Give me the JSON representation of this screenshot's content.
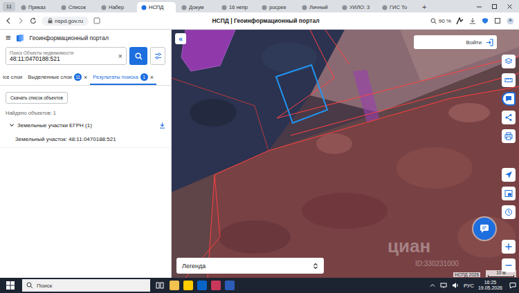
{
  "browser": {
    "tab_group": "11",
    "tabs": [
      {
        "label": "Приказ",
        "selected": false
      },
      {
        "label": "Список",
        "selected": false
      },
      {
        "label": "Набер",
        "selected": false
      },
      {
        "label": "НСПД",
        "selected": true
      },
      {
        "label": "Докум",
        "selected": false
      },
      {
        "label": "16 непр",
        "selected": false
      },
      {
        "label": "росрее",
        "selected": false
      },
      {
        "label": "Личный",
        "selected": false
      },
      {
        "label": "УИЛО: 3",
        "selected": false
      },
      {
        "label": "ГИС То",
        "selected": false
      }
    ],
    "new_tab": "+",
    "address": "nspd.gov.ru",
    "title": "НСПД | Геоинформационный портал",
    "zoom": "90 %"
  },
  "panel": {
    "menu": "≡",
    "title": "Геоинформационный портал",
    "search": {
      "label": "Поиск Объекты недвижимости",
      "value": "48:11:0470188:521",
      "clear": "×"
    },
    "tabs": [
      {
        "label": "ice слои",
        "selected": false
      },
      {
        "label": "Выделенные слои",
        "badge": "11",
        "close": "×",
        "selected": false
      },
      {
        "label": "Результаты поиска",
        "badge": "1",
        "close": "×",
        "selected": true
      }
    ],
    "download_button": "Скачать список объектов",
    "found": "Найдено объектов: 1",
    "groups": [
      {
        "label": "Земельные участки ЕГРН (1)",
        "expanded": true,
        "items": [
          "Земельный участок: 48:11:0470188:521"
        ]
      }
    ]
  },
  "map": {
    "collapse": "«",
    "login": "Войти",
    "tools": [
      {
        "kind": "layers",
        "selected": false
      },
      {
        "kind": "ruler",
        "selected": false
      },
      {
        "kind": "identify",
        "selected": true
      },
      {
        "kind": "share",
        "selected": false
      },
      {
        "kind": "print",
        "selected": false
      },
      {
        "kind": "locate",
        "selected": false
      },
      {
        "kind": "minimap",
        "selected": false
      },
      {
        "kind": "history",
        "selected": false
      },
      {
        "kind": "zoom-in",
        "selected": false
      },
      {
        "kind": "zoom-out",
        "selected": false
      }
    ],
    "legend": "Легенда",
    "watermark": "циан",
    "watermark_id": "ID:330231000",
    "attribution": "НСПД 2026",
    "scale": "10 м"
  },
  "taskbar": {
    "search": "Поиск",
    "lang": "РУС",
    "time": "16:25",
    "date": "19.05.2026"
  }
}
